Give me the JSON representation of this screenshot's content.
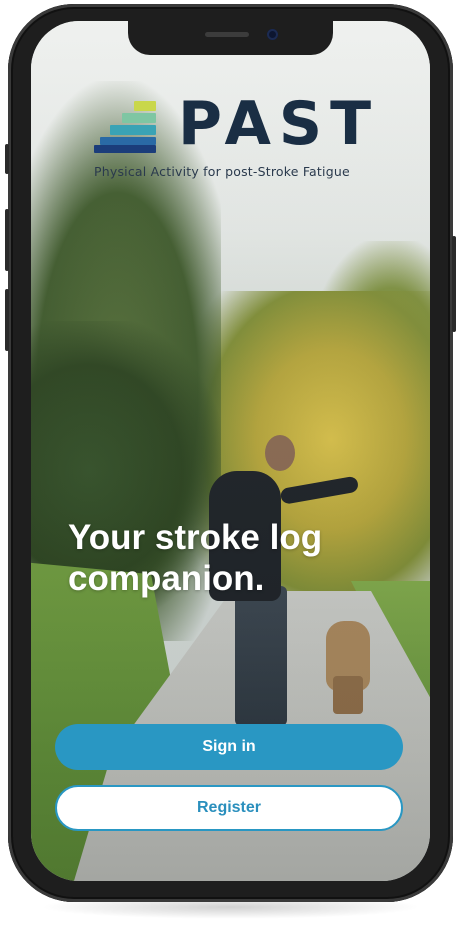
{
  "app": {
    "logo_word": "PAST",
    "logo_subtitle": "Physical Activity for post-Stroke Fatigue",
    "logo_colors": [
      "#1b3d7a",
      "#2a6aa5",
      "#3aa3b5",
      "#7fc6a3",
      "#c9d74a"
    ]
  },
  "hero": {
    "tagline": "Your stroke log companion."
  },
  "actions": {
    "signin_label": "Sign in",
    "register_label": "Register"
  },
  "colors": {
    "primary": "#2997c3",
    "logo_text": "#1a2e44"
  }
}
